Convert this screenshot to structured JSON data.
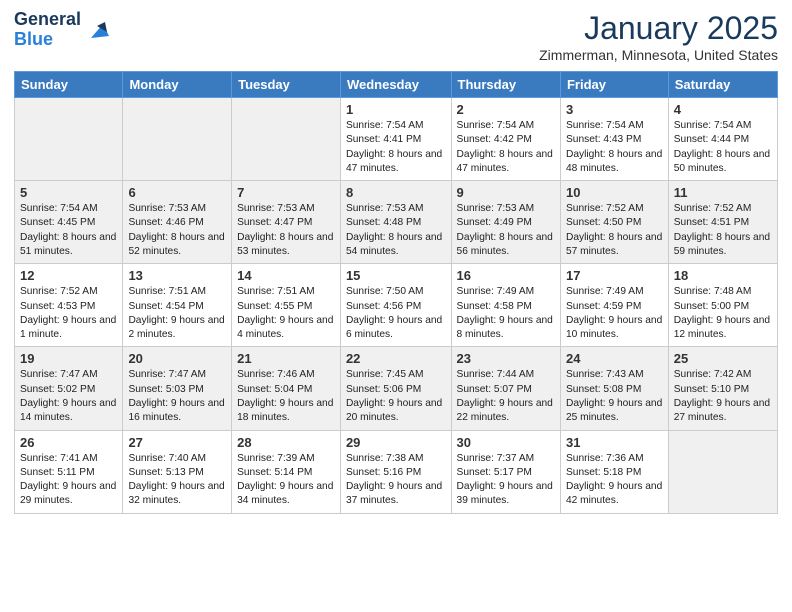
{
  "header": {
    "logo_general": "General",
    "logo_blue": "Blue",
    "month": "January 2025",
    "location": "Zimmerman, Minnesota, United States"
  },
  "columns": [
    "Sunday",
    "Monday",
    "Tuesday",
    "Wednesday",
    "Thursday",
    "Friday",
    "Saturday"
  ],
  "weeks": [
    [
      {
        "day": "",
        "info": ""
      },
      {
        "day": "",
        "info": ""
      },
      {
        "day": "",
        "info": ""
      },
      {
        "day": "1",
        "info": "Sunrise: 7:54 AM\nSunset: 4:41 PM\nDaylight: 8 hours and 47 minutes."
      },
      {
        "day": "2",
        "info": "Sunrise: 7:54 AM\nSunset: 4:42 PM\nDaylight: 8 hours and 47 minutes."
      },
      {
        "day": "3",
        "info": "Sunrise: 7:54 AM\nSunset: 4:43 PM\nDaylight: 8 hours and 48 minutes."
      },
      {
        "day": "4",
        "info": "Sunrise: 7:54 AM\nSunset: 4:44 PM\nDaylight: 8 hours and 50 minutes."
      }
    ],
    [
      {
        "day": "5",
        "info": "Sunrise: 7:54 AM\nSunset: 4:45 PM\nDaylight: 8 hours and 51 minutes."
      },
      {
        "day": "6",
        "info": "Sunrise: 7:53 AM\nSunset: 4:46 PM\nDaylight: 8 hours and 52 minutes."
      },
      {
        "day": "7",
        "info": "Sunrise: 7:53 AM\nSunset: 4:47 PM\nDaylight: 8 hours and 53 minutes."
      },
      {
        "day": "8",
        "info": "Sunrise: 7:53 AM\nSunset: 4:48 PM\nDaylight: 8 hours and 54 minutes."
      },
      {
        "day": "9",
        "info": "Sunrise: 7:53 AM\nSunset: 4:49 PM\nDaylight: 8 hours and 56 minutes."
      },
      {
        "day": "10",
        "info": "Sunrise: 7:52 AM\nSunset: 4:50 PM\nDaylight: 8 hours and 57 minutes."
      },
      {
        "day": "11",
        "info": "Sunrise: 7:52 AM\nSunset: 4:51 PM\nDaylight: 8 hours and 59 minutes."
      }
    ],
    [
      {
        "day": "12",
        "info": "Sunrise: 7:52 AM\nSunset: 4:53 PM\nDaylight: 9 hours and 1 minute."
      },
      {
        "day": "13",
        "info": "Sunrise: 7:51 AM\nSunset: 4:54 PM\nDaylight: 9 hours and 2 minutes."
      },
      {
        "day": "14",
        "info": "Sunrise: 7:51 AM\nSunset: 4:55 PM\nDaylight: 9 hours and 4 minutes."
      },
      {
        "day": "15",
        "info": "Sunrise: 7:50 AM\nSunset: 4:56 PM\nDaylight: 9 hours and 6 minutes."
      },
      {
        "day": "16",
        "info": "Sunrise: 7:49 AM\nSunset: 4:58 PM\nDaylight: 9 hours and 8 minutes."
      },
      {
        "day": "17",
        "info": "Sunrise: 7:49 AM\nSunset: 4:59 PM\nDaylight: 9 hours and 10 minutes."
      },
      {
        "day": "18",
        "info": "Sunrise: 7:48 AM\nSunset: 5:00 PM\nDaylight: 9 hours and 12 minutes."
      }
    ],
    [
      {
        "day": "19",
        "info": "Sunrise: 7:47 AM\nSunset: 5:02 PM\nDaylight: 9 hours and 14 minutes."
      },
      {
        "day": "20",
        "info": "Sunrise: 7:47 AM\nSunset: 5:03 PM\nDaylight: 9 hours and 16 minutes."
      },
      {
        "day": "21",
        "info": "Sunrise: 7:46 AM\nSunset: 5:04 PM\nDaylight: 9 hours and 18 minutes."
      },
      {
        "day": "22",
        "info": "Sunrise: 7:45 AM\nSunset: 5:06 PM\nDaylight: 9 hours and 20 minutes."
      },
      {
        "day": "23",
        "info": "Sunrise: 7:44 AM\nSunset: 5:07 PM\nDaylight: 9 hours and 22 minutes."
      },
      {
        "day": "24",
        "info": "Sunrise: 7:43 AM\nSunset: 5:08 PM\nDaylight: 9 hours and 25 minutes."
      },
      {
        "day": "25",
        "info": "Sunrise: 7:42 AM\nSunset: 5:10 PM\nDaylight: 9 hours and 27 minutes."
      }
    ],
    [
      {
        "day": "26",
        "info": "Sunrise: 7:41 AM\nSunset: 5:11 PM\nDaylight: 9 hours and 29 minutes."
      },
      {
        "day": "27",
        "info": "Sunrise: 7:40 AM\nSunset: 5:13 PM\nDaylight: 9 hours and 32 minutes."
      },
      {
        "day": "28",
        "info": "Sunrise: 7:39 AM\nSunset: 5:14 PM\nDaylight: 9 hours and 34 minutes."
      },
      {
        "day": "29",
        "info": "Sunrise: 7:38 AM\nSunset: 5:16 PM\nDaylight: 9 hours and 37 minutes."
      },
      {
        "day": "30",
        "info": "Sunrise: 7:37 AM\nSunset: 5:17 PM\nDaylight: 9 hours and 39 minutes."
      },
      {
        "day": "31",
        "info": "Sunrise: 7:36 AM\nSunset: 5:18 PM\nDaylight: 9 hours and 42 minutes."
      },
      {
        "day": "",
        "info": ""
      }
    ]
  ]
}
